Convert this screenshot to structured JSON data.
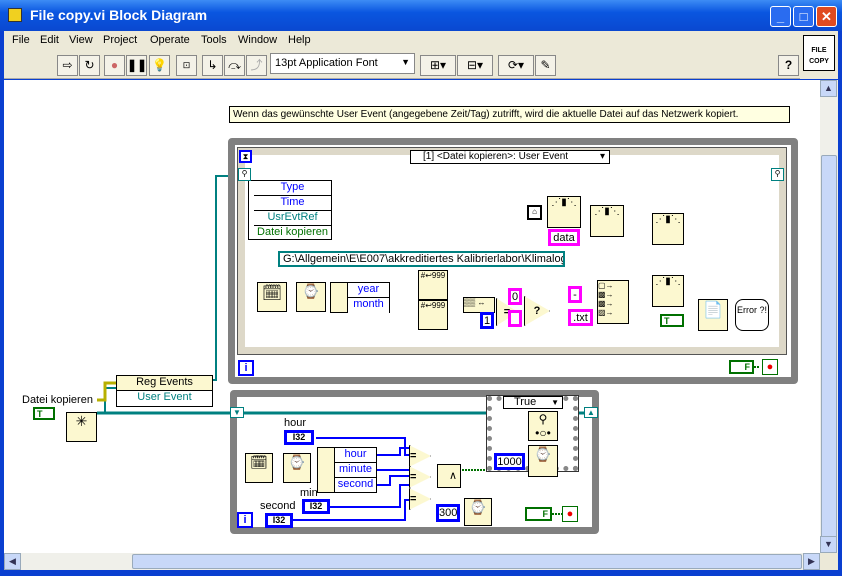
{
  "window": {
    "title": "File copy.vi Block Diagram",
    "icon_text": "FILE COPY"
  },
  "menu": [
    "File",
    "Edit",
    "View",
    "Project",
    "Operate",
    "Tools",
    "Window",
    "Help"
  ],
  "toolbar": {
    "font": "13pt Application Font",
    "help": "?"
  },
  "comment": "Wenn das gewünschte User Event (angegebene Zeit/Tag) zutrifft, wird die aktuelle Datei auf das Netzwerk kopiert.",
  "event_structure": {
    "selector": "[1] <Datei kopieren>: User Event",
    "event_data": [
      "Type",
      "Time",
      "UsrEvtRef",
      "Datei kopieren"
    ]
  },
  "constants": {
    "path": "G:\\Allgemein\\E\\E007\\akkreditiertes Kalibrierlabor\\Klimalogger",
    "data": "data",
    "zero": "0",
    "one": "1",
    "dash": "-",
    "txt": ".txt",
    "wait_ms": "1000",
    "loop_wait_ms": "300",
    "empty": ""
  },
  "unbundle_top": [
    "year",
    "month"
  ],
  "unbundle_bottom": [
    "hour",
    "minute",
    "second"
  ],
  "controls": {
    "hour": "hour",
    "min": "min",
    "second": "second",
    "i32": "I32",
    "datei_kopieren": "Datei kopieren"
  },
  "reg_events": {
    "title": "Reg Events",
    "item": "User Event"
  },
  "case_structure": {
    "selector": "True"
  },
  "booleans": {
    "true": "T",
    "false": "F"
  },
  "error_label": "Error ?!",
  "loop_index": "i",
  "colors": {
    "string_wire": "#ff00ff",
    "int_wire": "#0000ff",
    "ref_wire": "#008080",
    "bool_wire": "#007000",
    "title_bar": "#0a56e0"
  }
}
